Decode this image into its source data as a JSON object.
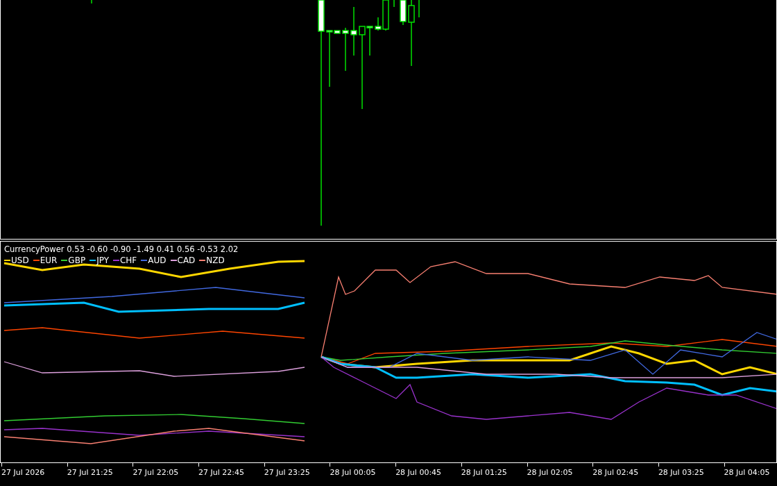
{
  "indicator": {
    "title": "CurrencyPower 0.53 -0.60 -0.90 -1.49 0.41 0.56 -0.53 2.02",
    "legend": [
      {
        "label": "USD",
        "color": "#ffd700"
      },
      {
        "label": "EUR",
        "color": "#ff4500"
      },
      {
        "label": "GBP",
        "color": "#32cd32"
      },
      {
        "label": "JPY",
        "color": "#00bfff"
      },
      {
        "label": "CHF",
        "color": "#9932cc"
      },
      {
        "label": "AUD",
        "color": "#4169e1"
      },
      {
        "label": "CAD",
        "color": "#dda0dd"
      },
      {
        "label": "NZD",
        "color": "#fa8072"
      }
    ]
  },
  "time_axis": [
    "27 Jul 2026",
    "27 Jul 21:25",
    "27 Jul 22:05",
    "27 Jul 22:45",
    "27 Jul 23:25",
    "28 Jul 00:05",
    "28 Jul 00:45",
    "28 Jul 01:25",
    "28 Jul 02:05",
    "28 Jul 02:45",
    "28 Jul 03:25",
    "28 Jul 04:05"
  ]
}
